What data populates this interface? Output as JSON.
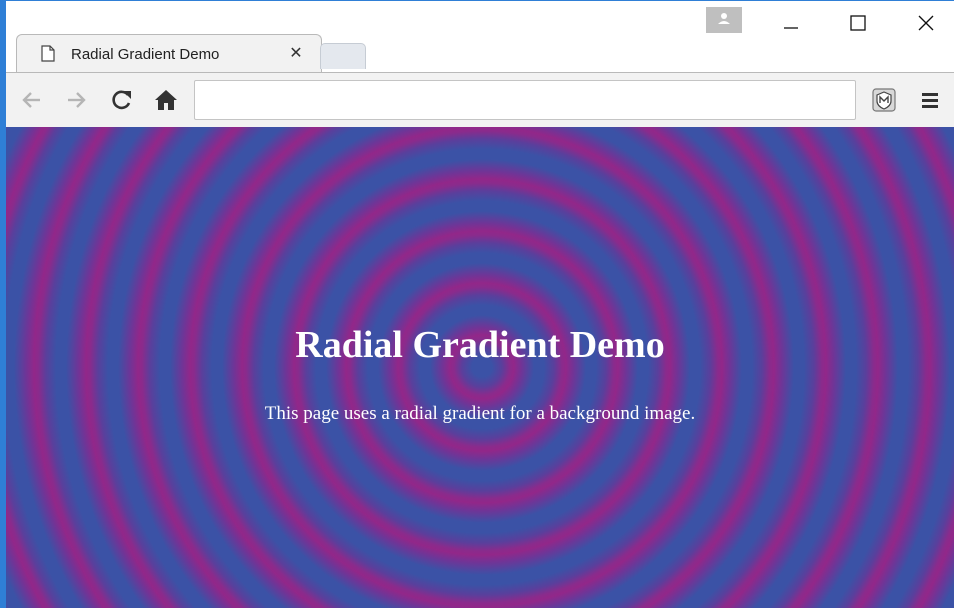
{
  "browser": {
    "tab": {
      "title": "Radial Gradient Demo",
      "close_glyph": "✕",
      "icon": "page-icon"
    },
    "new_tab_icon": "new-tab",
    "profile_icon": "person-icon",
    "window_controls": {
      "minimize_icon": "minimize-icon",
      "maximize_icon": "maximize-icon",
      "close_icon": "close-icon"
    },
    "toolbar": {
      "back_icon": "arrow-left-icon",
      "forward_icon": "arrow-right-icon",
      "reload_icon": "reload-icon",
      "home_icon": "home-icon",
      "address_value": "",
      "extension_icon": "extension-shield-icon",
      "menu_icon": "hamburger-menu-icon"
    }
  },
  "page": {
    "heading": "Radial Gradient Demo",
    "paragraph": "This page uses a radial gradient for a background image.",
    "gradient_colors": [
      "#3b52a6",
      "#922789"
    ]
  },
  "colors": {
    "window_border": "#2f7fd6",
    "toolbar_bg": "#f2f2f2"
  }
}
